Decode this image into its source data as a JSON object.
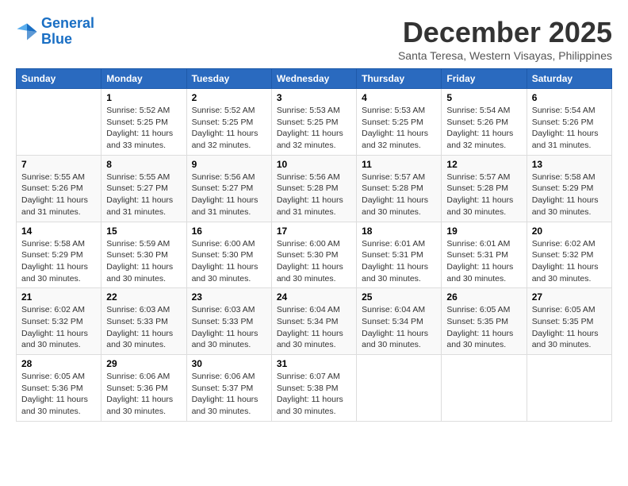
{
  "logo": {
    "line1": "General",
    "line2": "Blue"
  },
  "title": "December 2025",
  "subtitle": "Santa Teresa, Western Visayas, Philippines",
  "days_header": [
    "Sunday",
    "Monday",
    "Tuesday",
    "Wednesday",
    "Thursday",
    "Friday",
    "Saturday"
  ],
  "weeks": [
    [
      {
        "num": "",
        "info": ""
      },
      {
        "num": "1",
        "info": "Sunrise: 5:52 AM\nSunset: 5:25 PM\nDaylight: 11 hours\nand 33 minutes."
      },
      {
        "num": "2",
        "info": "Sunrise: 5:52 AM\nSunset: 5:25 PM\nDaylight: 11 hours\nand 32 minutes."
      },
      {
        "num": "3",
        "info": "Sunrise: 5:53 AM\nSunset: 5:25 PM\nDaylight: 11 hours\nand 32 minutes."
      },
      {
        "num": "4",
        "info": "Sunrise: 5:53 AM\nSunset: 5:25 PM\nDaylight: 11 hours\nand 32 minutes."
      },
      {
        "num": "5",
        "info": "Sunrise: 5:54 AM\nSunset: 5:26 PM\nDaylight: 11 hours\nand 32 minutes."
      },
      {
        "num": "6",
        "info": "Sunrise: 5:54 AM\nSunset: 5:26 PM\nDaylight: 11 hours\nand 31 minutes."
      }
    ],
    [
      {
        "num": "7",
        "info": "Sunrise: 5:55 AM\nSunset: 5:26 PM\nDaylight: 11 hours\nand 31 minutes."
      },
      {
        "num": "8",
        "info": "Sunrise: 5:55 AM\nSunset: 5:27 PM\nDaylight: 11 hours\nand 31 minutes."
      },
      {
        "num": "9",
        "info": "Sunrise: 5:56 AM\nSunset: 5:27 PM\nDaylight: 11 hours\nand 31 minutes."
      },
      {
        "num": "10",
        "info": "Sunrise: 5:56 AM\nSunset: 5:28 PM\nDaylight: 11 hours\nand 31 minutes."
      },
      {
        "num": "11",
        "info": "Sunrise: 5:57 AM\nSunset: 5:28 PM\nDaylight: 11 hours\nand 30 minutes."
      },
      {
        "num": "12",
        "info": "Sunrise: 5:57 AM\nSunset: 5:28 PM\nDaylight: 11 hours\nand 30 minutes."
      },
      {
        "num": "13",
        "info": "Sunrise: 5:58 AM\nSunset: 5:29 PM\nDaylight: 11 hours\nand 30 minutes."
      }
    ],
    [
      {
        "num": "14",
        "info": "Sunrise: 5:58 AM\nSunset: 5:29 PM\nDaylight: 11 hours\nand 30 minutes."
      },
      {
        "num": "15",
        "info": "Sunrise: 5:59 AM\nSunset: 5:30 PM\nDaylight: 11 hours\nand 30 minutes."
      },
      {
        "num": "16",
        "info": "Sunrise: 6:00 AM\nSunset: 5:30 PM\nDaylight: 11 hours\nand 30 minutes."
      },
      {
        "num": "17",
        "info": "Sunrise: 6:00 AM\nSunset: 5:30 PM\nDaylight: 11 hours\nand 30 minutes."
      },
      {
        "num": "18",
        "info": "Sunrise: 6:01 AM\nSunset: 5:31 PM\nDaylight: 11 hours\nand 30 minutes."
      },
      {
        "num": "19",
        "info": "Sunrise: 6:01 AM\nSunset: 5:31 PM\nDaylight: 11 hours\nand 30 minutes."
      },
      {
        "num": "20",
        "info": "Sunrise: 6:02 AM\nSunset: 5:32 PM\nDaylight: 11 hours\nand 30 minutes."
      }
    ],
    [
      {
        "num": "21",
        "info": "Sunrise: 6:02 AM\nSunset: 5:32 PM\nDaylight: 11 hours\nand 30 minutes."
      },
      {
        "num": "22",
        "info": "Sunrise: 6:03 AM\nSunset: 5:33 PM\nDaylight: 11 hours\nand 30 minutes."
      },
      {
        "num": "23",
        "info": "Sunrise: 6:03 AM\nSunset: 5:33 PM\nDaylight: 11 hours\nand 30 minutes."
      },
      {
        "num": "24",
        "info": "Sunrise: 6:04 AM\nSunset: 5:34 PM\nDaylight: 11 hours\nand 30 minutes."
      },
      {
        "num": "25",
        "info": "Sunrise: 6:04 AM\nSunset: 5:34 PM\nDaylight: 11 hours\nand 30 minutes."
      },
      {
        "num": "26",
        "info": "Sunrise: 6:05 AM\nSunset: 5:35 PM\nDaylight: 11 hours\nand 30 minutes."
      },
      {
        "num": "27",
        "info": "Sunrise: 6:05 AM\nSunset: 5:35 PM\nDaylight: 11 hours\nand 30 minutes."
      }
    ],
    [
      {
        "num": "28",
        "info": "Sunrise: 6:05 AM\nSunset: 5:36 PM\nDaylight: 11 hours\nand 30 minutes."
      },
      {
        "num": "29",
        "info": "Sunrise: 6:06 AM\nSunset: 5:36 PM\nDaylight: 11 hours\nand 30 minutes."
      },
      {
        "num": "30",
        "info": "Sunrise: 6:06 AM\nSunset: 5:37 PM\nDaylight: 11 hours\nand 30 minutes."
      },
      {
        "num": "31",
        "info": "Sunrise: 6:07 AM\nSunset: 5:38 PM\nDaylight: 11 hours\nand 30 minutes."
      },
      {
        "num": "",
        "info": ""
      },
      {
        "num": "",
        "info": ""
      },
      {
        "num": "",
        "info": ""
      }
    ]
  ]
}
